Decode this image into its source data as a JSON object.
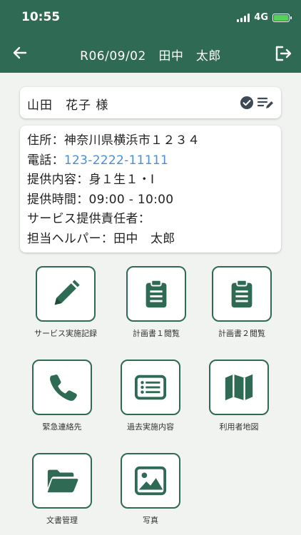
{
  "status": {
    "time": "10:55",
    "network": "4G"
  },
  "nav": {
    "title": "R06/09/02　田中　太郎"
  },
  "client": {
    "name": "山田　花子 様"
  },
  "info": {
    "address": "住所：神奈川県横浜市１２３４",
    "phone_label": "電話：",
    "phone": "123-2222-11111",
    "service": "提供内容：身１生１・Ⅰ",
    "time": "提供時間：09:00 - 10:00",
    "manager": "サービス提供責任者：",
    "helper": "担当ヘルパー：田中　太郎"
  },
  "tiles": [
    {
      "label": "サービス実施記録",
      "icon": "pencil-icon"
    },
    {
      "label": "計画書１閲覧",
      "icon": "clipboard-icon"
    },
    {
      "label": "計画書２閲覧",
      "icon": "clipboard-icon"
    },
    {
      "label": "緊急連絡先",
      "icon": "phone-icon"
    },
    {
      "label": "過去実施内容",
      "icon": "list-icon"
    },
    {
      "label": "利用者地図",
      "icon": "map-icon"
    },
    {
      "label": "文書管理",
      "icon": "folder-icon"
    },
    {
      "label": "写真",
      "icon": "image-icon"
    }
  ],
  "colors": {
    "primary": "#2e6a54",
    "link": "#4a8fd6",
    "background": "#f1f3f1",
    "battery": "#57d157"
  }
}
